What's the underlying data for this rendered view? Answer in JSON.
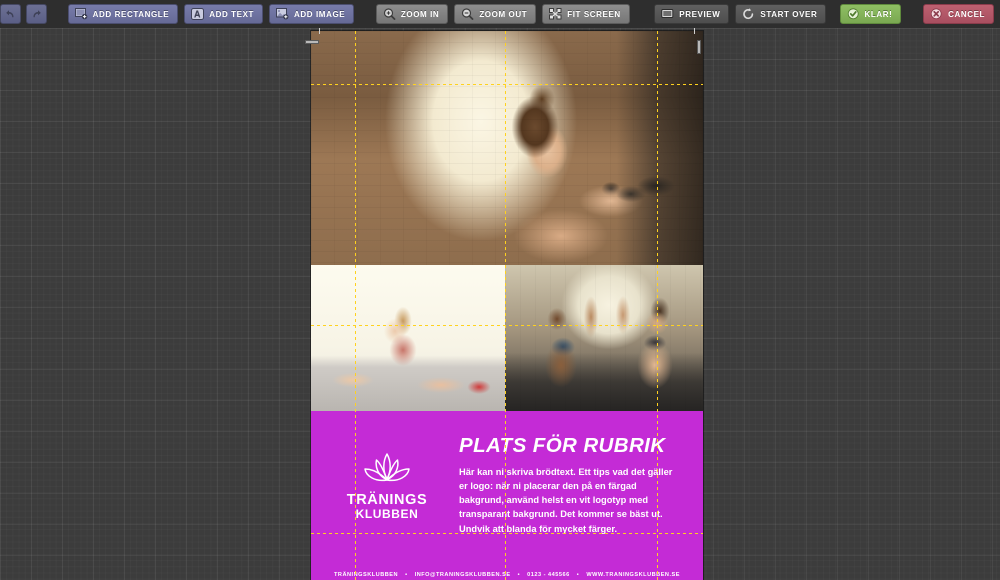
{
  "toolbar": {
    "undo": {
      "label": "",
      "icon": "undo-arrow-icon",
      "title": "Undo"
    },
    "redo": {
      "label": "",
      "icon": "redo-arrow-icon",
      "title": "Redo"
    },
    "buttons": [
      {
        "id": "add-rectangle",
        "label": "ADD RECTANGLE",
        "icon": "rectangle-plus-icon",
        "style": "blue"
      },
      {
        "id": "add-text",
        "label": "ADD TEXT",
        "icon": "text-aa-icon",
        "style": "blue"
      },
      {
        "id": "add-image",
        "label": "ADD IMAGE",
        "icon": "image-plus-icon",
        "style": "blue"
      },
      {
        "id": "zoom-in",
        "label": "ZOOM IN",
        "icon": "magnifier-plus-icon",
        "style": "gray"
      },
      {
        "id": "zoom-out",
        "label": "ZOOM OUT",
        "icon": "magnifier-minus-icon",
        "style": "gray"
      },
      {
        "id": "fit-screen",
        "label": "FIT SCREEN",
        "icon": "fit-screen-icon",
        "style": "gray"
      },
      {
        "id": "preview",
        "label": "PREVIEW",
        "icon": "monitor-icon",
        "style": "dark"
      },
      {
        "id": "start-over",
        "label": "START OVER",
        "icon": "refresh-circle-icon",
        "style": "dark"
      },
      {
        "id": "klar",
        "label": "KLAR!",
        "icon": "check-circle-icon",
        "style": "green"
      },
      {
        "id": "cancel",
        "label": "CANCEL",
        "icon": "x-circle-icon",
        "style": "red"
      }
    ]
  },
  "colors": {
    "toolbar_bg": "#2e2e2e",
    "workspace_bg": "#3c3c3c",
    "guide": "#ffd21e",
    "brand_purple": "#c42bd6",
    "accent_green": "#8fbf63",
    "accent_red": "#bd6070",
    "blue_button": "#787cab"
  },
  "poster": {
    "logo": {
      "icon": "lotus-flower-icon",
      "line1": "TRÄNINGS",
      "line2": "KLUBBEN"
    },
    "headline": "PLATS FÖR RUBRIK",
    "body": "Här kan ni skriva brödtext. Ett tips vad det gäller er logo: när ni placerar den på en färgad bakgrund, använd helst en vit logotyp med transparant bakgrund. Det kommer se bäst ut. Undvik att blanda för mycket färger.",
    "footer": {
      "company": "TRÄNINGSKLUBBEN",
      "email": "INFO@TRANINGSKLUBBEN.SE",
      "phone": "0123 - 445566",
      "website": "WWW.TRANINGSKLUBBEN.SE",
      "separator": "•"
    }
  }
}
